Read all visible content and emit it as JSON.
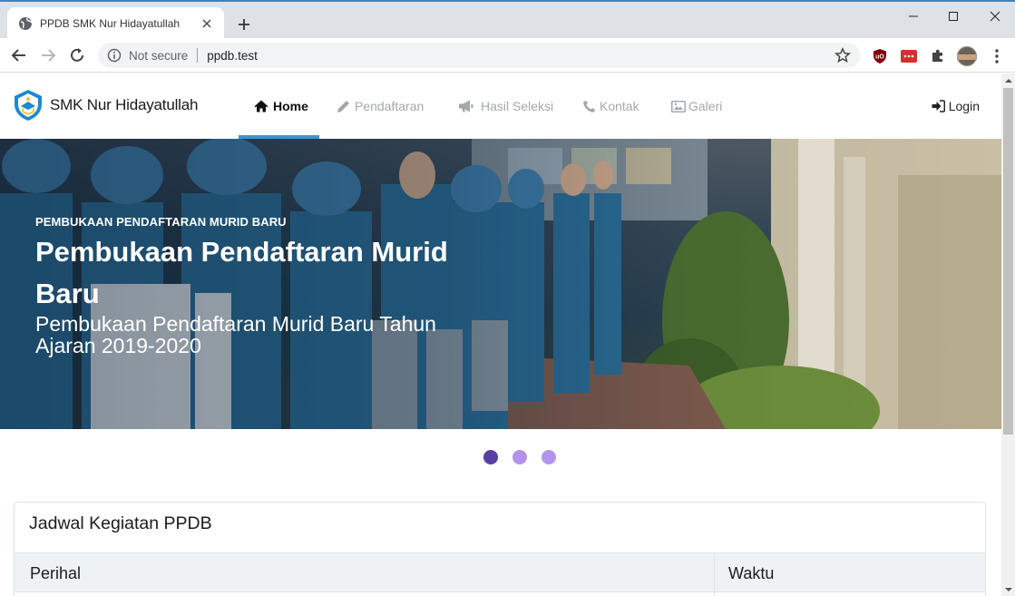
{
  "browser": {
    "tab_title": "PPDB SMK Nur Hidayatullah",
    "omnibox": {
      "security_label": "Not secure",
      "url": "ppdb.test"
    },
    "icons": [
      "globe-icon",
      "close-icon",
      "plus-icon",
      "back-icon",
      "forward-icon",
      "reload-icon",
      "info-icon",
      "star-icon",
      "ublock-icon",
      "extension-icon",
      "puzzle-icon",
      "avatar",
      "kebab-icon",
      "minimize-icon",
      "maximize-icon",
      "window-close-icon"
    ]
  },
  "navbar": {
    "brand": "SMK Nur Hidayatullah",
    "items": [
      {
        "label": "Home",
        "icon": "home-icon",
        "active": true
      },
      {
        "label": "Pendaftaran",
        "icon": "pencil-icon",
        "active": false
      },
      {
        "label": "Hasil Seleksi",
        "icon": "megaphone-icon",
        "active": false
      },
      {
        "label": "Kontak",
        "icon": "phone-icon",
        "active": false
      },
      {
        "label": "Galeri",
        "icon": "image-icon",
        "active": false
      }
    ],
    "login": "Login",
    "accent_color": "#3b96d2"
  },
  "hero": {
    "eyebrow": "PEMBUKAAN PENDAFTARAN MURID BARU",
    "title": "Pembukaan Pendaftaran Murid Baru",
    "subtitle": "Pembukaan Pendaftaran Murid Baru Tahun Ajaran 2019-2020"
  },
  "carousel": {
    "slide_count": 3,
    "active_index": 0,
    "dot_color": "#b393ec",
    "active_dot_color": "#5a3fa3"
  },
  "schedule": {
    "title": "Jadwal Kegiatan PPDB",
    "columns": [
      "Perihal",
      "Waktu"
    ]
  }
}
